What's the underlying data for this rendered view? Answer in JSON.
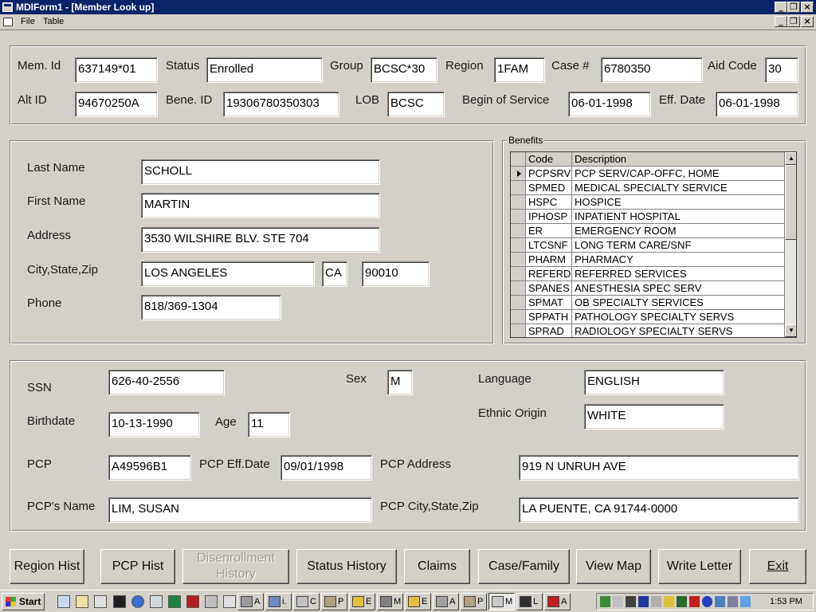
{
  "window": {
    "title": "MDIForm1 - [Member Look up]"
  },
  "menu": {
    "items": [
      "File",
      "Table"
    ]
  },
  "member": {
    "mem_id_label": "Mem. Id",
    "mem_id": "637149*01",
    "status_label": "Status",
    "status": "Enrolled",
    "group_label": "Group",
    "group": "BCSC*30",
    "region_label": "Region",
    "region": "1FAM",
    "case_label": "Case #",
    "case_no": "6780350",
    "aid_code_label": "Aid Code",
    "aid_code": "30",
    "alt_id_label": "Alt ID",
    "alt_id": "94670250A",
    "bene_id_label": "Bene. ID",
    "bene_id": "19306780350303",
    "lob_label": "LOB",
    "lob": "BCSC",
    "begin_service_label": "Begin of Service",
    "begin_service": "06-01-1998",
    "eff_date_label": "Eff. Date",
    "eff_date": "06-01-1998"
  },
  "address": {
    "last_name_label": "Last Name",
    "last_name": "SCHOLL",
    "first_name_label": "First Name",
    "first_name": "MARTIN",
    "address_label": "Address",
    "address": "3530 WILSHIRE BLV. STE 704",
    "city_state_zip_label": "City,State,Zip",
    "city": "LOS ANGELES",
    "state": "CA",
    "zip": "90010",
    "phone_label": "Phone",
    "phone": "818/369-1304"
  },
  "benefits": {
    "caption": "Benefits",
    "columns": [
      "Code",
      "Description"
    ],
    "rows": [
      {
        "code": "PCPSRV",
        "description": "PCP SERV/CAP-OFFC, HOME"
      },
      {
        "code": "SPMED",
        "description": "MEDICAL SPECIALTY SERVICE"
      },
      {
        "code": "HSPC",
        "description": "HOSPICE"
      },
      {
        "code": "IPHOSP",
        "description": "INPATIENT HOSPITAL"
      },
      {
        "code": "ER",
        "description": "EMERGENCY ROOM"
      },
      {
        "code": "LTCSNF",
        "description": "LONG TERM CARE/SNF"
      },
      {
        "code": "PHARM",
        "description": "PHARMACY"
      },
      {
        "code": "REFERD",
        "description": "REFERRED SERVICES"
      },
      {
        "code": "SPANES",
        "description": "ANESTHESIA SPEC SERV"
      },
      {
        "code": "SPMAT",
        "description": "OB SPECIALTY SERVICES"
      },
      {
        "code": "SPPATH",
        "description": "PATHOLOGY SPECIALTY SERVS"
      },
      {
        "code": "SPRAD",
        "description": "RADIOLOGY SPECIALTY SERVS"
      }
    ]
  },
  "details": {
    "ssn_label": "SSN",
    "ssn": "626-40-2556",
    "sex_label": "Sex",
    "sex": "M",
    "language_label": "Language",
    "language": "ENGLISH",
    "birthdate_label": "Birthdate",
    "birthdate": "10-13-1990",
    "age_label": "Age",
    "age": "11",
    "ethnic_label": "Ethnic Origin",
    "ethnic": "WHITE",
    "pcp_label": "PCP",
    "pcp": "A49596B1",
    "pcp_eff_label": "PCP Eff.Date",
    "pcp_eff": "09/01/1998",
    "pcp_address_label": "PCP Address",
    "pcp_address": "919 N UNRUH AVE",
    "pcp_name_label": "PCP's Name",
    "pcp_name": "LIM, SUSAN",
    "pcp_city_label": "PCP City,State,Zip",
    "pcp_city": "LA PUENTE, CA 91744-0000"
  },
  "buttons": {
    "region_hist": "Region Hist",
    "pcp_hist": "PCP Hist",
    "disenrollment_1": "Disenrollment",
    "disenrollment_2": "History",
    "status_history": "Status History",
    "claims": "Claims",
    "case_family": "Case/Family",
    "view_map": "View Map",
    "write_letter": "Write Letter",
    "exit": "Exit"
  },
  "taskbar": {
    "start": "Start",
    "tasks": [
      "A",
      "i.",
      "C",
      "P",
      "E",
      "M",
      "E",
      "A",
      "P",
      "M",
      "L",
      "A"
    ],
    "clock": "1:53 PM"
  }
}
